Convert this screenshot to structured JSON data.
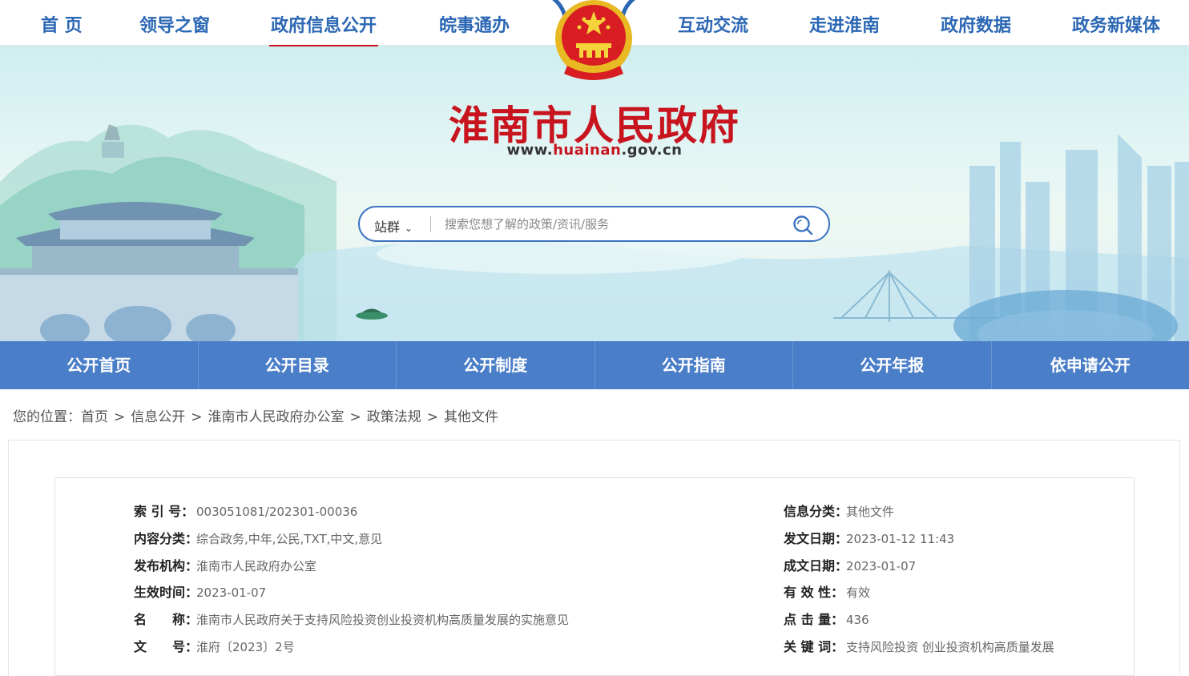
{
  "top_nav": [
    {
      "label": "首 页",
      "active": false
    },
    {
      "label": "领导之窗",
      "active": false
    },
    {
      "label": "政府信息公开",
      "active": true
    },
    {
      "label": "皖事通办",
      "active": false
    },
    {
      "label": "互动交流",
      "active": false
    },
    {
      "label": "走进淮南",
      "active": false
    },
    {
      "label": "政府数据",
      "active": false
    },
    {
      "label": "政务新媒体",
      "active": false
    }
  ],
  "header": {
    "site_title": "淮南市人民政府",
    "url_prefix": "www.",
    "url_highlight": "huainan",
    "url_suffix": ".gov.cn"
  },
  "search": {
    "scope": "站群",
    "placeholder": "搜索您想了解的政策/资讯/服务"
  },
  "section_nav": [
    "公开首页",
    "公开目录",
    "公开制度",
    "公开指南",
    "公开年报",
    "依申请公开"
  ],
  "breadcrumb": {
    "prefix": "您的位置：",
    "items": [
      "首页",
      "信息公开",
      "淮南市人民政府办公室",
      "政策法规",
      "其他文件"
    ]
  },
  "meta": {
    "left": [
      {
        "key": "索 引 号：",
        "value": "003051081/202301-00036"
      },
      {
        "key": "内容分类：",
        "value": "综合政务,中年,公民,TXT,中文,意见"
      },
      {
        "key": "发布机构：",
        "value": "淮南市人民政府办公室"
      },
      {
        "key": "生效时间：",
        "value": "2023-01-07"
      },
      {
        "key": "名　　称：",
        "value": "淮南市人民政府关于支持风险投资创业投资机构高质量发展的实施意见"
      },
      {
        "key": "文　　号：",
        "value": "淮府〔2023〕2号"
      }
    ],
    "right": [
      {
        "key": "信息分类：",
        "value": "其他文件"
      },
      {
        "key": "发文日期：",
        "value": "2023-01-12 11:43"
      },
      {
        "key": "成文日期：",
        "value": "2023-01-07"
      },
      {
        "key": "有 效 性：",
        "value": "有效"
      },
      {
        "key": "点 击 量：",
        "value": "436"
      },
      {
        "key": "关 键 词：",
        "value": "支持风险投资 创业投资机构高质量发展"
      }
    ]
  },
  "colors": {
    "brand_blue": "#2b67b4",
    "nav_blue": "#4a7ec8",
    "title_red": "#c8141e"
  },
  "icons": [
    "national-emblem-icon",
    "chevron-down-icon",
    "search-icon"
  ]
}
